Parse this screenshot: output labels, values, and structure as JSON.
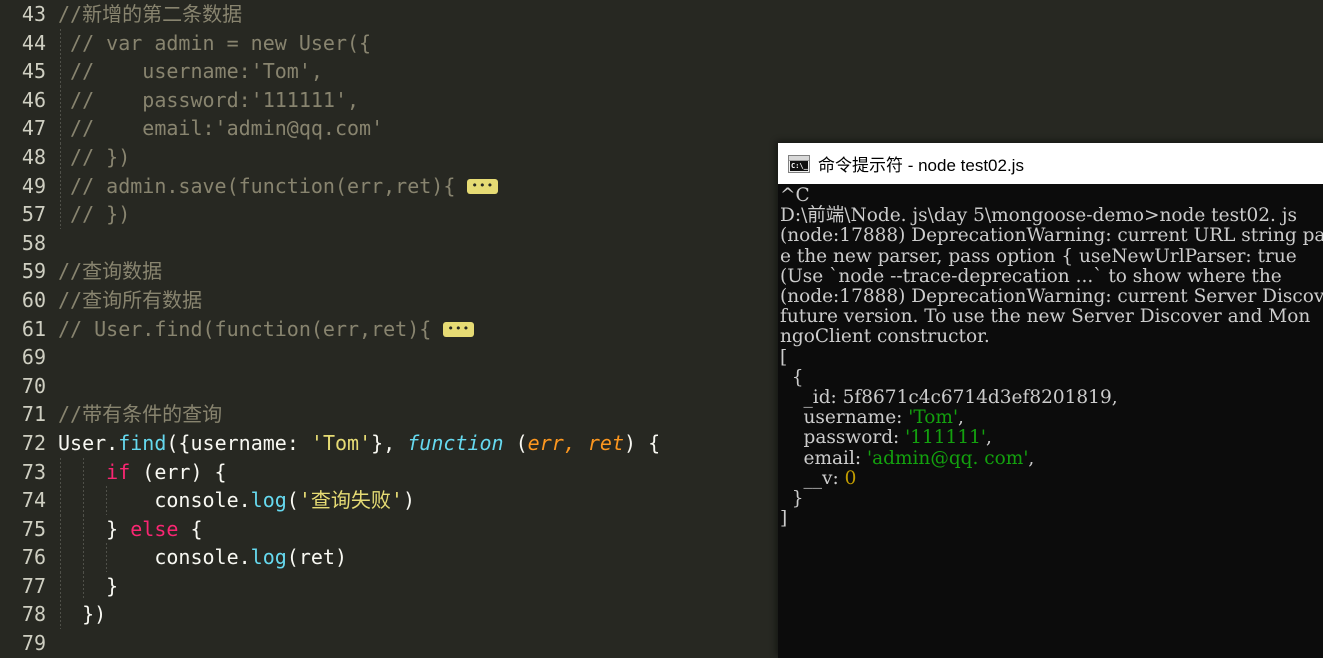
{
  "editor": {
    "theme_bg": "#272822",
    "line_number_color": "#cfcfc2",
    "lines": [
      {
        "num": "43",
        "indent": 0,
        "tokens": [
          {
            "t": "//新增的第二条数据",
            "c": "cm"
          }
        ]
      },
      {
        "num": "44",
        "indent": 1,
        "tokens": [
          {
            "t": " // var admin = new User({",
            "c": "cm"
          }
        ]
      },
      {
        "num": "45",
        "indent": 1,
        "tokens": [
          {
            "t": " //    username:'Tom',",
            "c": "cm"
          }
        ]
      },
      {
        "num": "46",
        "indent": 1,
        "tokens": [
          {
            "t": " //    password:'111111',",
            "c": "cm"
          }
        ]
      },
      {
        "num": "47",
        "indent": 1,
        "tokens": [
          {
            "t": " //    email:'admin@qq.com'",
            "c": "cm"
          }
        ]
      },
      {
        "num": "48",
        "indent": 1,
        "tokens": [
          {
            "t": " // })",
            "c": "cm"
          }
        ]
      },
      {
        "num": "49",
        "indent": 1,
        "tokens": [
          {
            "t": " // admin.save(function(err,ret){",
            "c": "cm"
          },
          {
            "t": "FOLD",
            "c": "fold"
          }
        ]
      },
      {
        "num": "57",
        "indent": 1,
        "tokens": [
          {
            "t": " // })",
            "c": "cm"
          }
        ]
      },
      {
        "num": "58",
        "indent": 0,
        "tokens": []
      },
      {
        "num": "59",
        "indent": 0,
        "tokens": [
          {
            "t": "//查询数据",
            "c": "cm"
          }
        ]
      },
      {
        "num": "60",
        "indent": 0,
        "tokens": [
          {
            "t": "//查询所有数据",
            "c": "cm"
          }
        ]
      },
      {
        "num": "61",
        "indent": 0,
        "tokens": [
          {
            "t": "// User.find(function(err,ret){",
            "c": "cm"
          },
          {
            "t": "FOLD",
            "c": "fold"
          }
        ]
      },
      {
        "num": "69",
        "indent": 0,
        "tokens": []
      },
      {
        "num": "70",
        "indent": 0,
        "tokens": []
      },
      {
        "num": "71",
        "indent": 0,
        "tokens": [
          {
            "t": "//带有条件的查询",
            "c": "cm"
          }
        ]
      },
      {
        "num": "72",
        "indent": 0,
        "tokens": [
          {
            "t": "User",
            "c": "plain"
          },
          {
            "t": ".",
            "c": "plain"
          },
          {
            "t": "find",
            "c": "fn"
          },
          {
            "t": "({",
            "c": "plain"
          },
          {
            "t": "username",
            "c": "plain"
          },
          {
            "t": ": ",
            "c": "plain"
          },
          {
            "t": "'Tom'",
            "c": "str"
          },
          {
            "t": "}, ",
            "c": "plain"
          },
          {
            "t": "function",
            "c": "kwi"
          },
          {
            "t": " (",
            "c": "plain"
          },
          {
            "t": "err, ret",
            "c": "par"
          },
          {
            "t": ") {",
            "c": "plain"
          }
        ]
      },
      {
        "num": "73",
        "indent": 2,
        "tokens": [
          {
            "t": "    ",
            "c": "plain"
          },
          {
            "t": "if",
            "c": "kw"
          },
          {
            "t": " (err) {",
            "c": "plain"
          }
        ]
      },
      {
        "num": "74",
        "indent": 3,
        "tokens": [
          {
            "t": "        ",
            "c": "plain"
          },
          {
            "t": "console",
            "c": "plain"
          },
          {
            "t": ".",
            "c": "plain"
          },
          {
            "t": "log",
            "c": "fn"
          },
          {
            "t": "(",
            "c": "plain"
          },
          {
            "t": "'查询失败'",
            "c": "str"
          },
          {
            "t": ")",
            "c": "plain"
          }
        ]
      },
      {
        "num": "75",
        "indent": 2,
        "tokens": [
          {
            "t": "    } ",
            "c": "plain"
          },
          {
            "t": "else",
            "c": "kw"
          },
          {
            "t": " {",
            "c": "plain"
          }
        ]
      },
      {
        "num": "76",
        "indent": 3,
        "tokens": [
          {
            "t": "        ",
            "c": "plain"
          },
          {
            "t": "console",
            "c": "plain"
          },
          {
            "t": ".",
            "c": "plain"
          },
          {
            "t": "log",
            "c": "fn"
          },
          {
            "t": "(ret)",
            "c": "plain"
          }
        ]
      },
      {
        "num": "77",
        "indent": 2,
        "tokens": [
          {
            "t": "    }",
            "c": "plain"
          }
        ]
      },
      {
        "num": "78",
        "indent": 1,
        "tokens": [
          {
            "t": "  })",
            "c": "plain"
          }
        ]
      },
      {
        "num": "79",
        "indent": 0,
        "tokens": []
      }
    ],
    "fold_marker_label": "•••"
  },
  "terminal": {
    "icon_name": "cmd-icon",
    "icon_glyph": "C:\\_",
    "title": "命令提示符 - node  test02.js",
    "background": "#0c0c0c",
    "foreground": "#cccccc",
    "lines": [
      {
        "segs": [
          {
            "t": "^C",
            "c": ""
          }
        ]
      },
      {
        "segs": [
          {
            "t": "D:\\前端\\Node. js\\day 5\\mongoose-demo>node test02. js",
            "c": ""
          }
        ]
      },
      {
        "segs": [
          {
            "t": "(node:17888) DeprecationWarning: current URL string pa",
            "c": ""
          }
        ]
      },
      {
        "segs": [
          {
            "t": "e the new parser, pass option { useNewUrlParser: true ",
            "c": ""
          }
        ]
      },
      {
        "segs": [
          {
            "t": "(Use `node --trace-deprecation ...` to show where the ",
            "c": ""
          }
        ]
      },
      {
        "segs": [
          {
            "t": "(node:17888) DeprecationWarning: current Server Discov",
            "c": ""
          }
        ]
      },
      {
        "segs": [
          {
            "t": "future version. To use the new Server Discover and Mon",
            "c": ""
          }
        ]
      },
      {
        "segs": [
          {
            "t": "ngoClient constructor.",
            "c": ""
          }
        ]
      },
      {
        "segs": [
          {
            "t": "[",
            "c": ""
          }
        ]
      },
      {
        "segs": [
          {
            "t": "  {",
            "c": ""
          }
        ]
      },
      {
        "segs": [
          {
            "t": "    _id: 5f8671c4c6714d3ef8201819,",
            "c": ""
          }
        ]
      },
      {
        "segs": [
          {
            "t": "    username: ",
            "c": ""
          },
          {
            "t": "'Tom'",
            "c": "tgreen"
          },
          {
            "t": ",",
            "c": ""
          }
        ]
      },
      {
        "segs": [
          {
            "t": "    password: ",
            "c": ""
          },
          {
            "t": "'111111'",
            "c": "tgreen"
          },
          {
            "t": ",",
            "c": ""
          }
        ]
      },
      {
        "segs": [
          {
            "t": "    email: ",
            "c": ""
          },
          {
            "t": "'admin@qq. com'",
            "c": "tgreen"
          },
          {
            "t": ",",
            "c": ""
          }
        ]
      },
      {
        "segs": [
          {
            "t": "    __v: ",
            "c": ""
          },
          {
            "t": "0",
            "c": "tyellow"
          }
        ]
      },
      {
        "segs": [
          {
            "t": "  }",
            "c": ""
          }
        ]
      },
      {
        "segs": [
          {
            "t": "]",
            "c": ""
          }
        ]
      }
    ]
  }
}
